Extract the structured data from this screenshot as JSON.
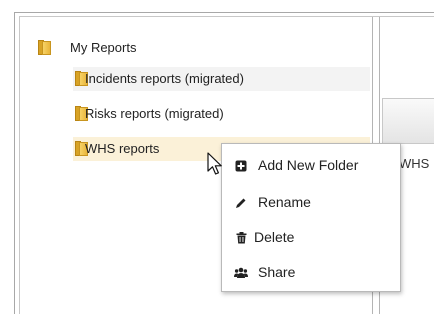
{
  "tree": {
    "root_label": "My Reports",
    "children": [
      {
        "label": "Incidents reports (migrated)"
      },
      {
        "label": "Risks reports (migrated)"
      },
      {
        "label": "WHS reports"
      }
    ]
  },
  "right_pane": {
    "peek_text": "WHS"
  },
  "context_menu": {
    "items": [
      {
        "label": "Add New Folder",
        "icon": "plus-square-icon"
      },
      {
        "label": "Rename",
        "icon": "pencil-icon"
      },
      {
        "label": "Delete",
        "icon": "trash-icon"
      },
      {
        "label": "Share",
        "icon": "users-icon"
      }
    ]
  }
}
